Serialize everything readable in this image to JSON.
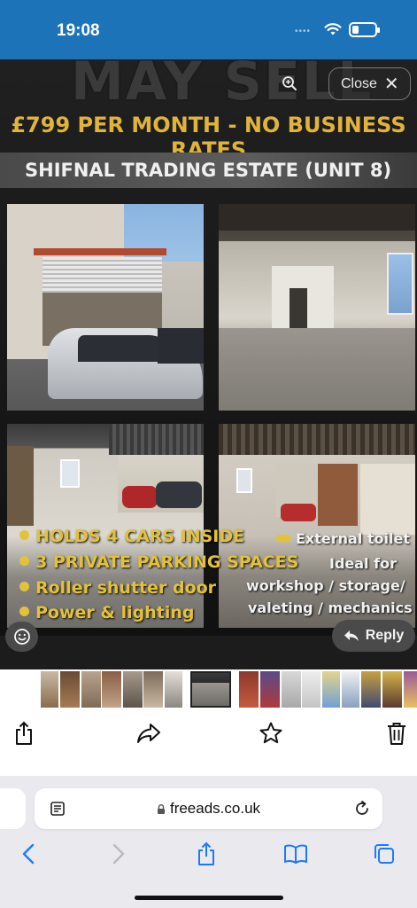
{
  "status": {
    "time": "19:08"
  },
  "ad": {
    "headline": "MAY SELL",
    "price_line": "£799 PER MONTH - NO BUSINESS RATES",
    "location": "SHIFNAL TRADING ESTATE (UNIT 8)",
    "features_left": [
      "HOLDS 4 CARS INSIDE",
      "3 PRIVATE PARKING SPACES",
      "Roller shutter door",
      "Power & lighting"
    ],
    "features_right": [
      "External toilet",
      "Ideal for",
      "workshop / storage/",
      "valeting / mechanics"
    ]
  },
  "viewer": {
    "close_label": "Close",
    "reply_label": "Reply"
  },
  "browser": {
    "url": "freeads.co.uk"
  },
  "icons": [
    "zoom-icon",
    "close-icon",
    "emoji-icon",
    "reply-arrow-icon",
    "share-icon",
    "forward-icon",
    "star-icon",
    "trash-icon",
    "reader-icon",
    "lock-icon",
    "reload-icon",
    "back-icon",
    "forward-nav-icon",
    "bookmarks-icon",
    "tabs-icon"
  ],
  "colors": {
    "status_bar": "#1d73b8",
    "accent": "#1a7aff",
    "ad_gold": "#e3c23a"
  }
}
